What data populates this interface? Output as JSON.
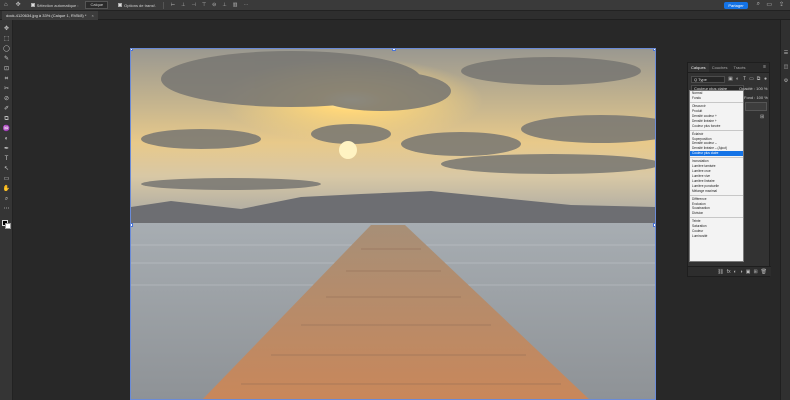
{
  "options_bar": {
    "move_icon": "move-tool-icon",
    "auto_select_label": "Sélection automatique :",
    "target_select": "Calque",
    "transform_label": "Options de transf.",
    "align_glyphs": [
      "⊢",
      "⊥",
      "⊣",
      "⊤",
      "⊖",
      "⊥",
      "▥",
      "⋯"
    ],
    "share_label": "Partager"
  },
  "document_tab": {
    "title": "dock-4120634.jpg à 33% (Calque 1, RVB/8) *",
    "close": "×"
  },
  "tools": [
    "✥",
    "⬚",
    "◯",
    "✎",
    "⊡",
    "⌗",
    "✂",
    "⊘",
    "✐",
    "⧉",
    "♒",
    "◐",
    "✒",
    "T",
    "↖",
    "▭",
    "✋",
    "⌕",
    "⋯"
  ],
  "layers_panel": {
    "tabs": [
      "Calques",
      "Couches",
      "Tracés"
    ],
    "active_tab": 0,
    "menu_glyph": "≡",
    "kind_filter": "Q Type",
    "blend_mode": "Couleur plus claire",
    "opacity_label": "Opacité : 100 %",
    "fill_label": "Fond : 100 %",
    "footer_icons": [
      "⛓",
      "fx",
      "◐",
      "◑",
      "▣",
      "⊞",
      "🗑"
    ]
  },
  "blend_dropdown": {
    "groups": [
      [
        "Normal",
        "Fondu"
      ],
      [
        "Obscurcir",
        "Produit",
        "Densité couleur +",
        "Densité linéaire +",
        "Couleur plus foncée"
      ],
      [
        "Éclaircir",
        "Superposition",
        "Densité couleur –",
        "Densité linéaire – (Ajout)",
        "Couleur plus claire"
      ],
      [
        "Incrustation",
        "Lumière tamisée",
        "Lumière crue",
        "Lumière vive",
        "Lumière linéaire",
        "Lumière ponctuelle",
        "Mélange maximal"
      ],
      [
        "Différence",
        "Exclusion",
        "Soustraction",
        "Division"
      ],
      [
        "Teinte",
        "Saturation",
        "Couleur",
        "Luminosité"
      ]
    ],
    "selected": "Couleur plus claire"
  },
  "right_strip_icons": [
    "☰",
    "◫",
    "⚙"
  ]
}
